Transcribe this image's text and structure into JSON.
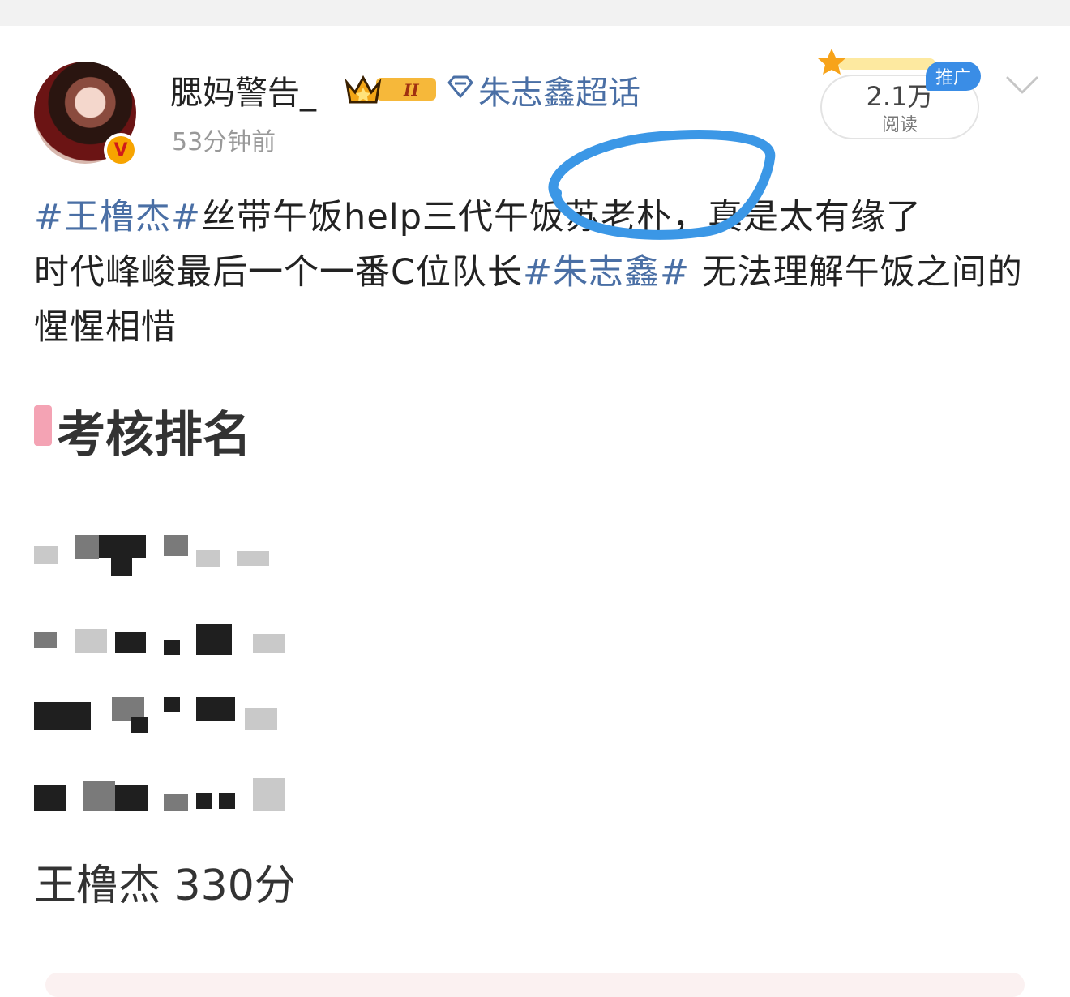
{
  "post": {
    "author": "腮妈警告_",
    "topic": "朱志鑫超话",
    "time": "53分钟前",
    "reads": {
      "count": "2.1万",
      "label": "阅读"
    },
    "promo_tag": "推广",
    "text": {
      "tag1": "#王橹杰#",
      "line1_rest": "丝带午饭help三代午饭苏老朴，真是太有缘了",
      "line2_start": "时代峰峻最后一个一番C位队长",
      "tag2": "#朱志鑫#",
      "line2_rest": " 无法理解午饭之间的惺惺相惜"
    }
  },
  "image": {
    "title": "考核排名",
    "visible_score": "王橹杰 330分"
  },
  "colors": {
    "link": "#4a6fa5",
    "annotation": "#3b97e6",
    "promo": "#3a8de6"
  }
}
